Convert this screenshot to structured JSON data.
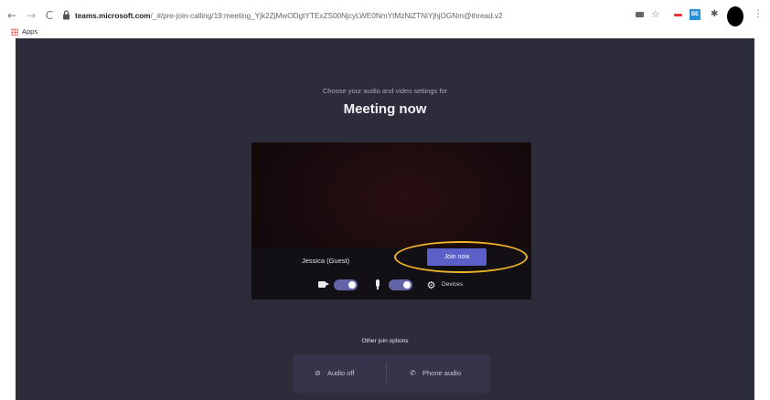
{
  "browser": {
    "back_glyph": "←",
    "forward_glyph": "→",
    "reload_glyph": "C",
    "url_host": "teams.microsoft.com",
    "url_path": "/_#/pre-join-calling/19:meeting_Yjk2ZjMwODgtYTExZS00NjcyLWE0NmYtMzNiZTNiYjhjOGNm@thread.v2",
    "extensions": [
      "camera-icon",
      "star-icon",
      "red-extension-icon",
      "blue-extension-icon",
      "puzzle-icon"
    ],
    "star_glyph": "☆",
    "blue_ext_text": "BE",
    "puzzle_glyph": "✱",
    "kebab_glyph": "⋮",
    "bookmarks": {
      "apps_label": "Apps"
    }
  },
  "prejoin": {
    "subtitle": "Choose your audio and video settings for",
    "title": "Meeting now",
    "guest_name": "Jessica (Guest)",
    "join_label": "Join now",
    "devices_label": "Devices",
    "gear_glyph": "⚙",
    "camera_on": true,
    "mic_on": true
  },
  "other_options": {
    "label": "Other join options",
    "audio_off_label": "Audio off",
    "audio_off_glyph": "⊘",
    "phone_label": "Phone audio",
    "phone_glyph": "✆"
  },
  "colors": {
    "stage_bg": "#2d2c3b",
    "accent": "#5b5fc7",
    "toggle_on": "#6264a7",
    "highlight": "#f0b429"
  }
}
